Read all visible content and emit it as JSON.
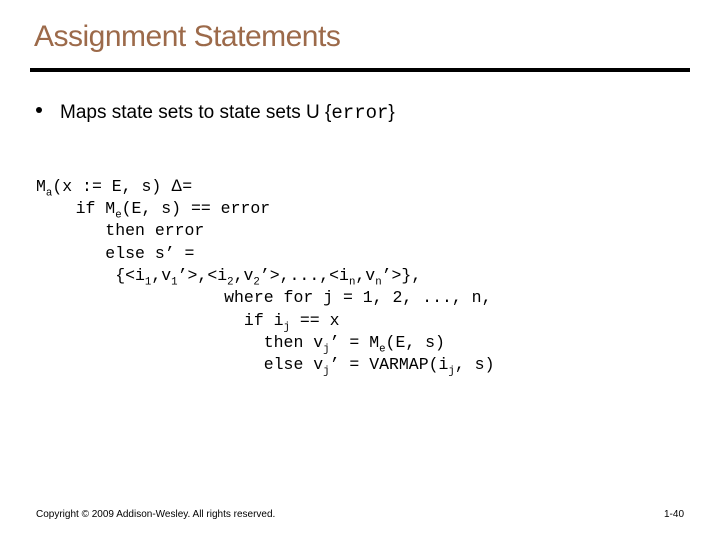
{
  "title": "Assignment Statements",
  "bullet": {
    "pre": "Maps state sets to state sets U {",
    "mono": "error",
    "post": "}"
  },
  "code": {
    "l1a": "M",
    "l1b": "a",
    "l1c": "(x := E, s) ",
    "l1delta": "Δ",
    "l1d": "=",
    "l2a": "    if M",
    "l2b": "e",
    "l2c": "(E, s) == error",
    "l3": "       then error",
    "l4": "       else s’ =",
    "l5a": "        {<i",
    "l5b": "1",
    "l5c": ",v",
    "l5d": "1",
    "l5e": "’>,<i",
    "l5f": "2",
    "l5g": ",v",
    "l5h": "2",
    "l5i": "’>,...,<i",
    "l5j": "n",
    "l5k": ",v",
    "l5l": "n",
    "l5m": "’>},",
    "l6": "                   where for j = 1, 2, ..., n,",
    "l7a": "                     if i",
    "l7b": "j",
    "l7c": " == x",
    "l8a": "                       then v",
    "l8b": "j",
    "l8c": "’ = M",
    "l8d": "e",
    "l8e": "(E, s)",
    "l9a": "                       else v",
    "l9b": "j",
    "l9c": "’ = VARMAP(i",
    "l9d": "j",
    "l9e": ", s)"
  },
  "footer": {
    "copyright": "Copyright © 2009 Addison-Wesley. All rights reserved.",
    "page": "1-40"
  }
}
